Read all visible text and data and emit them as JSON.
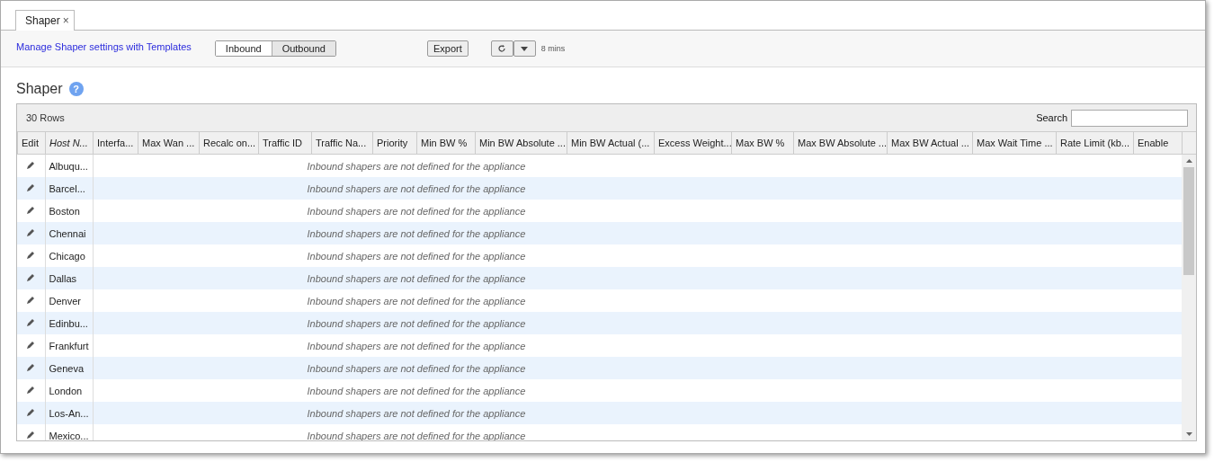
{
  "tabs": [
    {
      "label": "Shaper",
      "selected": true,
      "close": "×"
    }
  ],
  "toolbar": {
    "link": "Manage Shaper settings with Templates",
    "direction": [
      {
        "label": "Inbound",
        "selected": true
      },
      {
        "label": "Outbound",
        "selected": false
      }
    ],
    "export": "Export",
    "refresh_age": "8 mins"
  },
  "heading": "Shaper",
  "help": "?",
  "grid": {
    "row_count": "30 Rows",
    "search_label": "Search",
    "columns": [
      {
        "label": "Edit",
        "sorted": false
      },
      {
        "label": "Host N...",
        "sorted": true
      },
      {
        "label": "Interfa...",
        "sorted": false
      },
      {
        "label": "Max Wan ...",
        "sorted": false
      },
      {
        "label": "Recalc on...",
        "sorted": false
      },
      {
        "label": "Traffic ID",
        "sorted": false
      },
      {
        "label": "Traffic Na...",
        "sorted": false
      },
      {
        "label": "Priority",
        "sorted": false
      },
      {
        "label": "Min BW %",
        "sorted": false
      },
      {
        "label": "Min BW Absolute ...",
        "sorted": false
      },
      {
        "label": "Min BW Actual (...",
        "sorted": false
      },
      {
        "label": "Excess Weight...",
        "sorted": false
      },
      {
        "label": "Max BW %",
        "sorted": false
      },
      {
        "label": "Max BW Absolute ...",
        "sorted": false
      },
      {
        "label": "Max BW Actual ...",
        "sorted": false
      },
      {
        "label": "Max Wait Time ...",
        "sorted": false
      },
      {
        "label": "Rate Limit (kb...",
        "sorted": false
      },
      {
        "label": "Enable",
        "sorted": false
      }
    ],
    "rows": [
      {
        "host": "Albuqu...",
        "message": "Inbound shapers are not defined for the appliance"
      },
      {
        "host": "Barcel...",
        "message": "Inbound shapers are not defined for the appliance"
      },
      {
        "host": "Boston",
        "message": "Inbound shapers are not defined for the appliance"
      },
      {
        "host": "Chennai",
        "message": "Inbound shapers are not defined for the appliance"
      },
      {
        "host": "Chicago",
        "message": "Inbound shapers are not defined for the appliance"
      },
      {
        "host": "Dallas",
        "message": "Inbound shapers are not defined for the appliance"
      },
      {
        "host": "Denver",
        "message": "Inbound shapers are not defined for the appliance"
      },
      {
        "host": "Edinbu...",
        "message": "Inbound shapers are not defined for the appliance"
      },
      {
        "host": "Frankfurt",
        "message": "Inbound shapers are not defined for the appliance"
      },
      {
        "host": "Geneva",
        "message": "Inbound shapers are not defined for the appliance"
      },
      {
        "host": "London",
        "message": "Inbound shapers are not defined for the appliance"
      },
      {
        "host": "Los-An...",
        "message": "Inbound shapers are not defined for the appliance"
      },
      {
        "host": "Mexico...",
        "message": "Inbound shapers are not defined for the appliance"
      }
    ]
  }
}
